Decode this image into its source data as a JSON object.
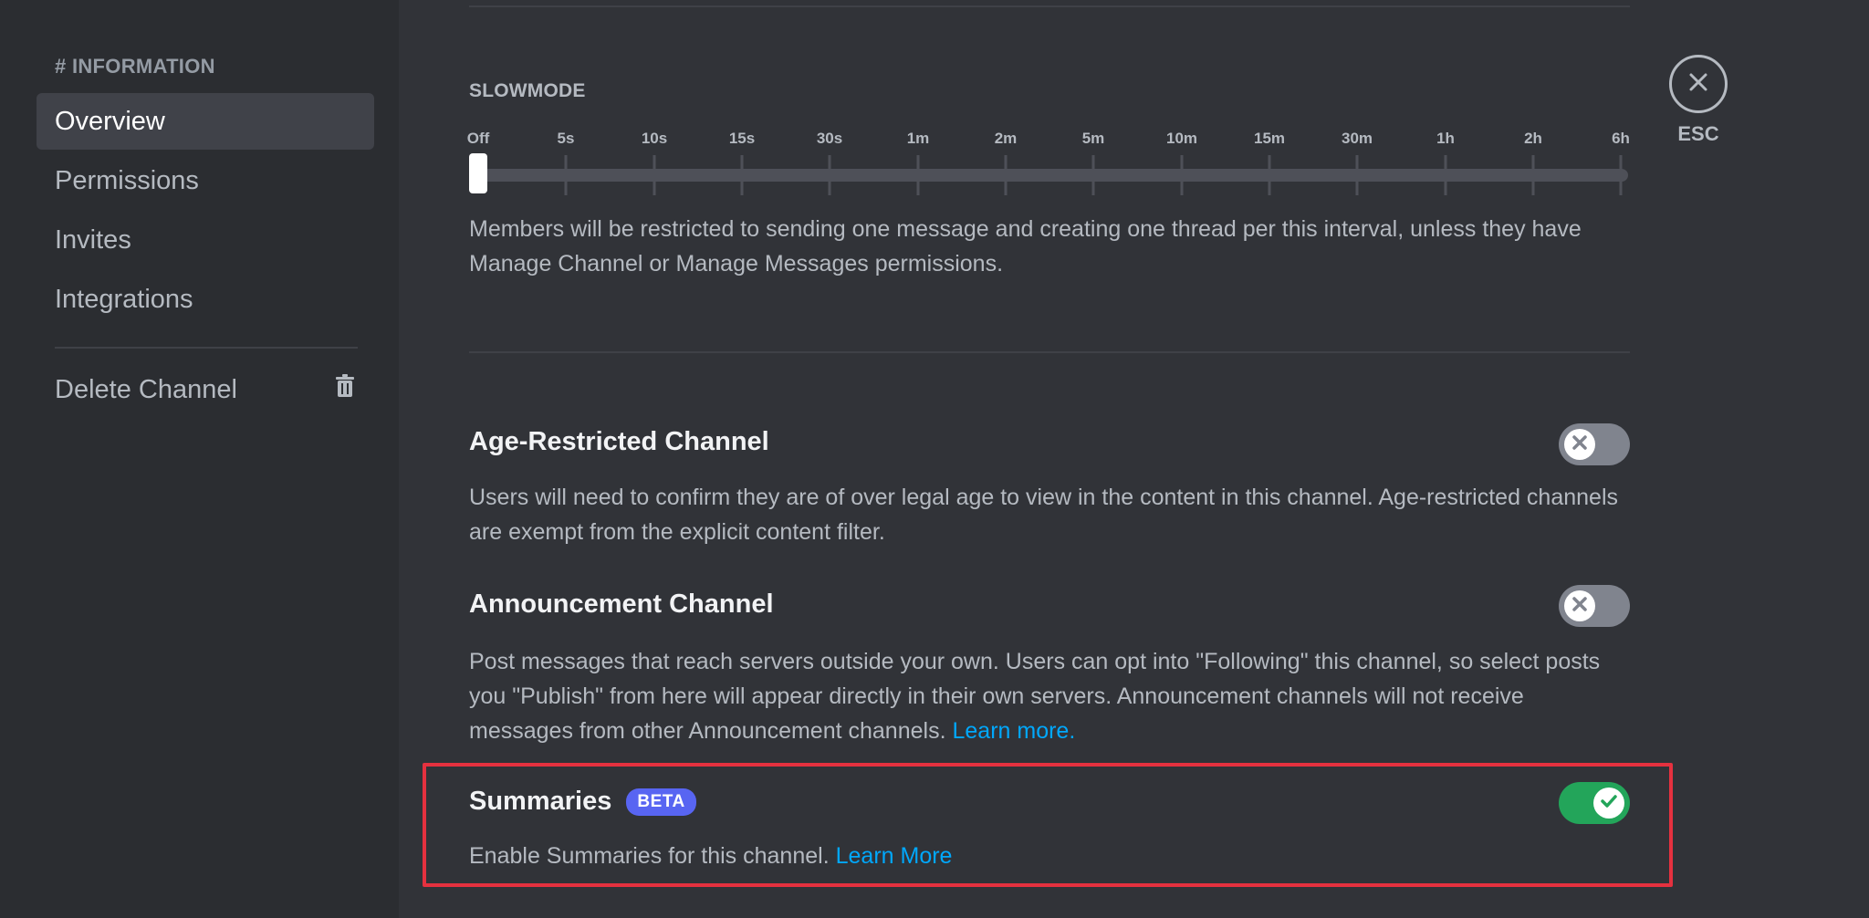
{
  "sidebar": {
    "header": "# INFORMATION",
    "items": [
      {
        "label": "Overview"
      },
      {
        "label": "Permissions"
      },
      {
        "label": "Invites"
      },
      {
        "label": "Integrations"
      }
    ],
    "delete_label": "Delete Channel",
    "delete_icon": "trash-icon"
  },
  "slowmode": {
    "label": "SLOWMODE",
    "options": [
      "Off",
      "5s",
      "10s",
      "15s",
      "30s",
      "1m",
      "2m",
      "5m",
      "10m",
      "15m",
      "30m",
      "1h",
      "2h",
      "6h"
    ],
    "selected": "Off",
    "description": "Members will be restricted to sending one message and creating one thread per this interval, unless they have Manage Channel or Manage Messages permissions."
  },
  "age_restricted": {
    "title": "Age-Restricted Channel",
    "description": "Users will need to confirm they are of over legal age to view in the content in this channel. Age-restricted channels are exempt from the explicit content filter.",
    "enabled": false
  },
  "announcement": {
    "title": "Announcement Channel",
    "description": "Post messages that reach servers outside your own. Users can opt into \"Following\" this channel, so select posts you \"Publish\" from here will appear directly in their own servers. Announcement channels will not receive messages from other Announcement channels.",
    "link": "Learn more.",
    "enabled": false
  },
  "summaries": {
    "title": "Summaries",
    "badge": "BETA",
    "description": "Enable Summaries for this channel.",
    "link": "Learn More",
    "enabled": true
  },
  "close": {
    "label": "ESC",
    "icon": "close-icon"
  },
  "colors": {
    "background": "#313338",
    "sidebar": "#2b2d31",
    "accent": "#5865f2",
    "link": "#00a8fc",
    "toggle_on": "#23a55a",
    "toggle_off": "#80848e",
    "highlight": "#e5313f"
  }
}
